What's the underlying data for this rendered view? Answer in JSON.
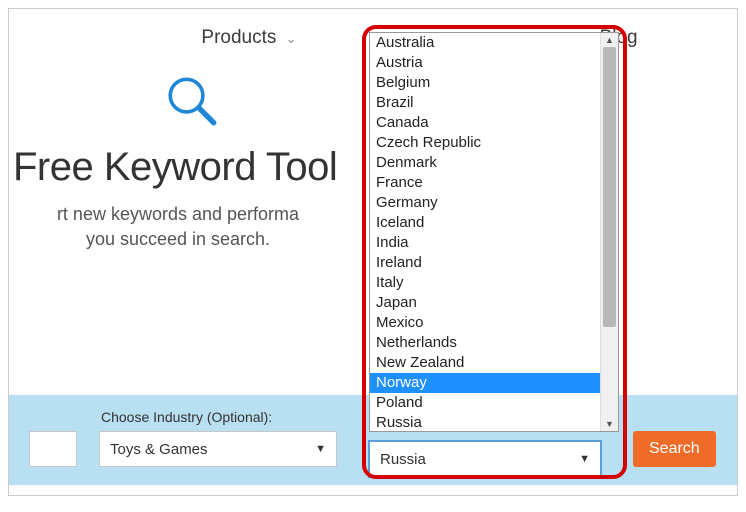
{
  "nav": {
    "products": "Products",
    "blog": "Blog"
  },
  "hero": {
    "title": "Free Keyword Tool",
    "subtitle_line1": "rt new keywords and performa",
    "subtitle_line2": "you succeed in search."
  },
  "filters": {
    "industry_label": "Choose Industry (Optional):",
    "industry_value": "Toys & Games",
    "country_value": "Russia"
  },
  "dropdown": {
    "items": [
      "Australia",
      "Austria",
      "Belgium",
      "Brazil",
      "Canada",
      "Czech Republic",
      "Denmark",
      "France",
      "Germany",
      "Iceland",
      "India",
      "Ireland",
      "Italy",
      "Japan",
      "Mexico",
      "Netherlands",
      "New Zealand",
      "Norway",
      "Poland",
      "Russia"
    ],
    "highlighted": "Norway"
  },
  "buttons": {
    "search": "Search"
  }
}
